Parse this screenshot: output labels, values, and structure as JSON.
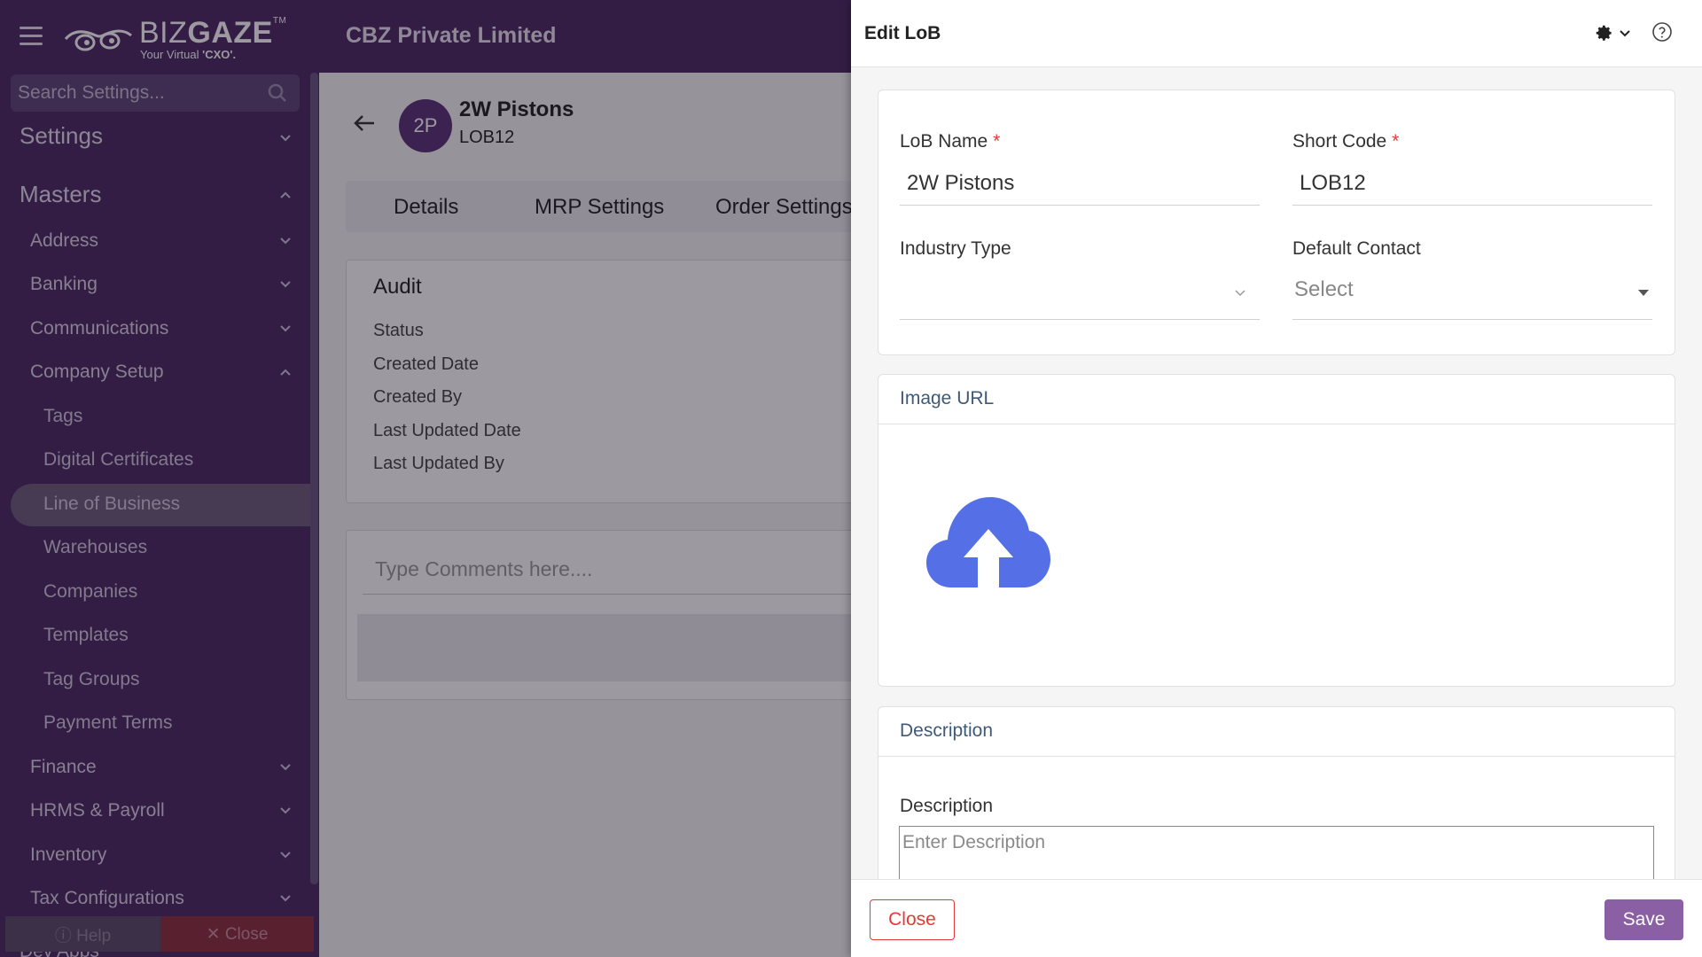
{
  "header": {
    "logo": {
      "brand_light": "BIZ",
      "brand_bold": "GAZE",
      "trademark": "TM",
      "tagline_pre": "Your Virtual ",
      "tagline_bold": "'CXO'."
    },
    "company_name": "CBZ Private Limited"
  },
  "sidebar": {
    "search_placeholder": "Search Settings...",
    "settings_label": "Settings",
    "masters_label": "Masters",
    "items": [
      {
        "label": "Address",
        "expanded": false
      },
      {
        "label": "Banking",
        "expanded": false
      },
      {
        "label": "Communications",
        "expanded": false
      },
      {
        "label": "Company Setup",
        "expanded": true
      },
      {
        "label": "Finance",
        "expanded": false
      },
      {
        "label": "HRMS & Payroll",
        "expanded": false
      },
      {
        "label": "Inventory",
        "expanded": false
      },
      {
        "label": "Tax Configurations",
        "expanded": false
      },
      {
        "label": "Dev Apps",
        "expanded": false
      }
    ],
    "company_setup_children": [
      "Tags",
      "Digital Certificates",
      "Line of Business",
      "Warehouses",
      "Companies",
      "Templates",
      "Tag Groups",
      "Payment Terms"
    ],
    "active_child": "Line of Business",
    "help_label": "Help",
    "close_label": "Close"
  },
  "record": {
    "avatar_initials": "2P",
    "title": "2W Pistons",
    "code": "LOB12",
    "tabs": [
      "Details",
      "MRP Settings",
      "Order Settings"
    ],
    "audit_title": "Audit",
    "audit_rows": [
      "Status",
      "Created Date",
      "Created By",
      "Last Updated Date",
      "Last Updated By"
    ],
    "comment_placeholder": "Type Comments here...."
  },
  "drawer": {
    "title": "Edit LoB",
    "required_marker": "*",
    "lob_name_label": "LoB Name",
    "lob_name_value": "2W Pistons",
    "short_code_label": "Short Code",
    "short_code_value": "LOB12",
    "industry_type_label": "Industry Type",
    "industry_type_value": "",
    "default_contact_label": "Default Contact",
    "default_contact_value": "Select",
    "image_url_title": "Image URL",
    "description_section_title": "Description",
    "description_label": "Description",
    "description_placeholder": "Enter Description",
    "close_button": "Close",
    "save_button": "Save"
  },
  "colors": {
    "sidebar_bg": "#4a2a63",
    "accent_purple": "#8a5fa3",
    "upload_blue": "#5570e6",
    "danger_red": "#e53935"
  },
  "icons": [
    "hamburger-icon",
    "owl-logo-icon",
    "search-icon",
    "chevron-down-icon",
    "chevron-up-icon",
    "back-arrow-icon",
    "gear-icon",
    "help-circle-icon",
    "cloud-upload-icon",
    "dropdown-caret-icon"
  ]
}
